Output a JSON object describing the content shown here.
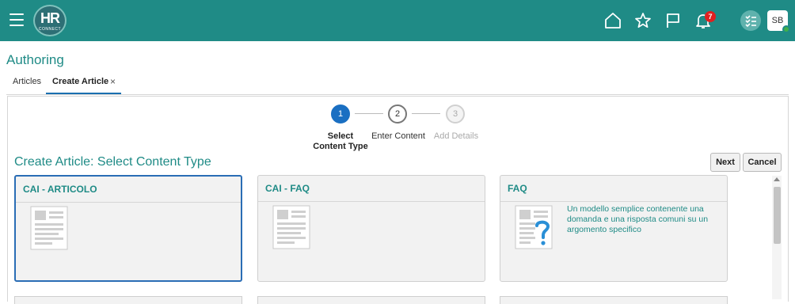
{
  "header": {
    "logo_main": "HR",
    "logo_sub": "CONNECT",
    "notification_count": "7",
    "avatar_initials": "SB",
    "icons": [
      "menu-icon",
      "home-icon",
      "star-icon",
      "flag-icon",
      "bell-icon",
      "tasks-icon"
    ],
    "brand_color": "#1f8b86"
  },
  "page": {
    "title": "Authoring"
  },
  "tabs": [
    {
      "label": "Articles",
      "active": false
    },
    {
      "label": "Create Article",
      "active": true,
      "closable": true
    }
  ],
  "tab_close_glyph": "×",
  "stepper": {
    "steps": [
      {
        "number": "1",
        "label_line1": "Select",
        "label_line2": "Content Type",
        "state": "current"
      },
      {
        "number": "2",
        "label_line1": "Enter Content",
        "label_line2": "",
        "state": "upcoming"
      },
      {
        "number": "3",
        "label_line1": "Add Details",
        "label_line2": "",
        "state": "disabled"
      }
    ]
  },
  "main": {
    "section_title": "Create Article: Select Content Type",
    "next_label": "Next",
    "cancel_label": "Cancel"
  },
  "cards": [
    {
      "title": "CAI - ARTICOLO",
      "description": "",
      "icon": "document-icon",
      "selected": true
    },
    {
      "title": "CAI - FAQ",
      "description": "",
      "icon": "document-icon",
      "selected": false
    },
    {
      "title": "FAQ",
      "description": "Un modello semplice contenente una domanda e una risposta comuni su un argomento specifico",
      "icon": "faq-document-icon",
      "selected": false
    }
  ]
}
